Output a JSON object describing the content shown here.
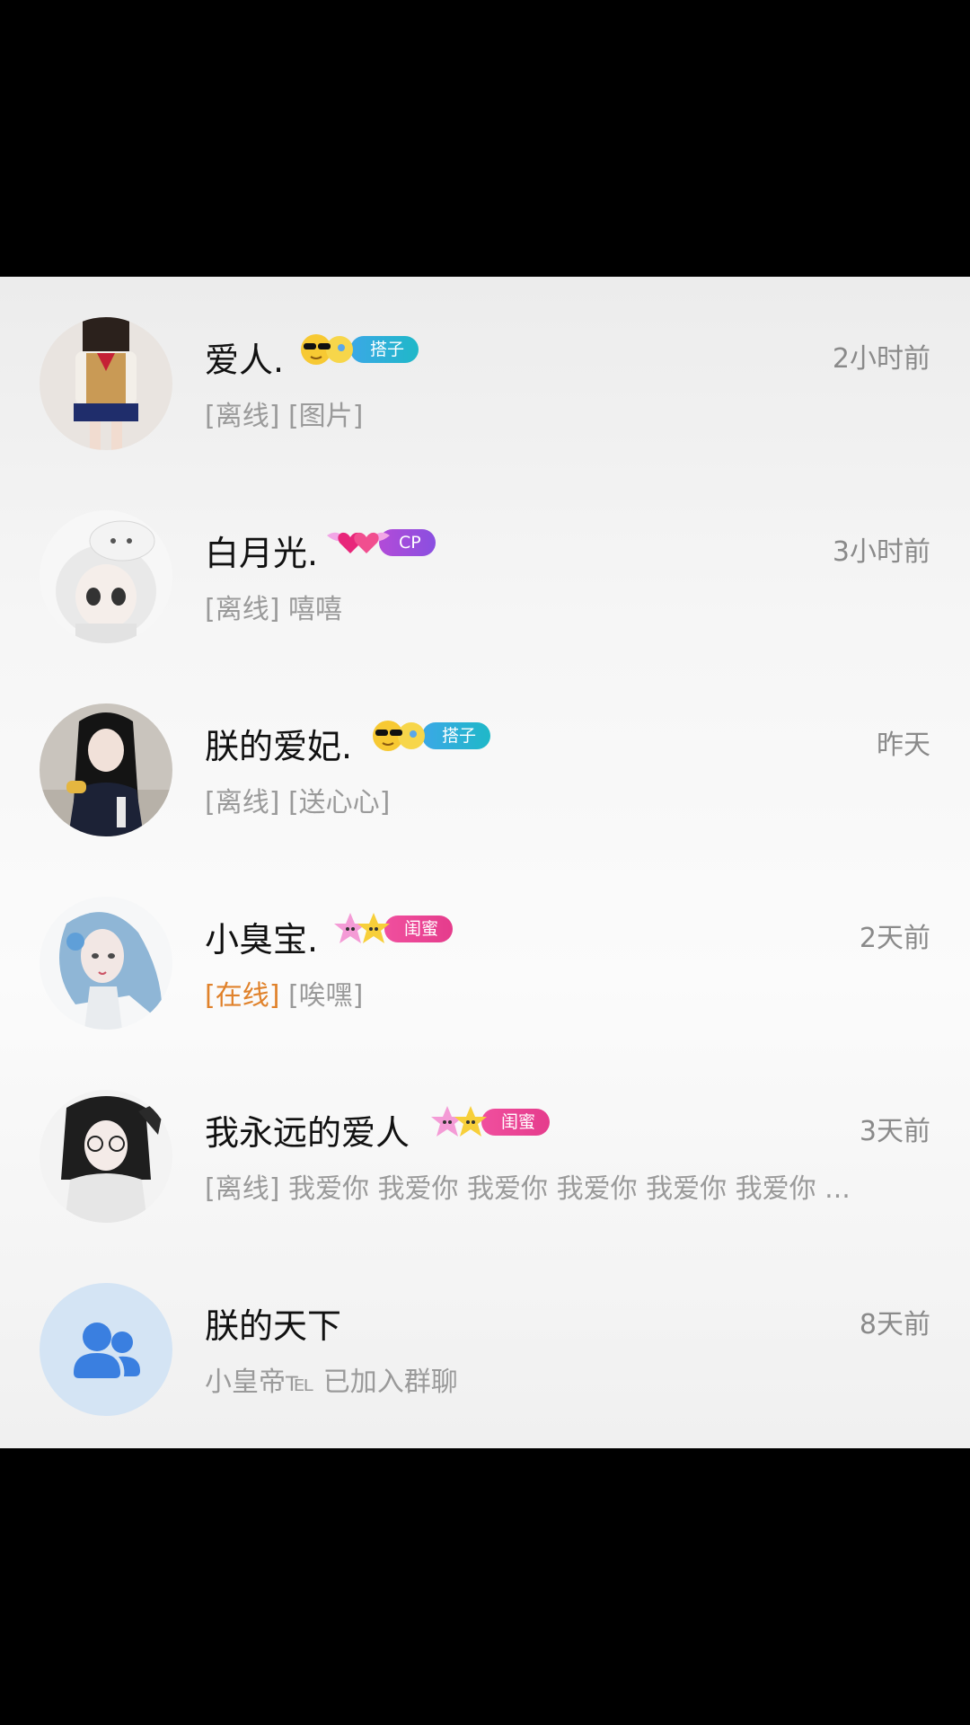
{
  "chats": [
    {
      "name": "爱人.",
      "badge": {
        "label": "搭子",
        "type": "dazi",
        "emoji": "sunglasses-sun-icon"
      },
      "time": "2小时前",
      "status": "[离线]",
      "online": false,
      "preview": " [图片]"
    },
    {
      "name": "白月光.",
      "badge": {
        "label": "CP",
        "type": "cp",
        "emoji": "winged-hearts-icon"
      },
      "time": "3小时前",
      "status": "[离线]",
      "online": false,
      "preview": " 嘻嘻"
    },
    {
      "name": "朕的爱妃.",
      "badge": {
        "label": "搭子",
        "type": "dazi",
        "emoji": "sunglasses-sun-icon"
      },
      "time": "昨天",
      "status": "[离线]",
      "online": false,
      "preview": " [送心心]"
    },
    {
      "name": "小臭宝.",
      "badge": {
        "label": "闺蜜",
        "type": "guimi",
        "emoji": "stars-icon"
      },
      "time": "2天前",
      "status": "[在线]",
      "online": true,
      "preview": " [唉嘿]"
    },
    {
      "name": "我永远的爱人",
      "badge": {
        "label": "闺蜜",
        "type": "guimi",
        "emoji": "stars-icon"
      },
      "time": "3天前",
      "status": "[离线]",
      "online": false,
      "preview": " 我爱你 我爱你 我爱你 我爱你 我爱你 我爱你 ..."
    },
    {
      "name": "朕的天下",
      "badge": null,
      "time": "8天前",
      "status": "",
      "online": false,
      "preview": "小皇帝℡ 已加入群聊"
    }
  ],
  "colors": {
    "online": "#e0822b",
    "muted": "#9a9a9a",
    "group_avatar_bg": "#d4e4f4",
    "group_icon": "#3a7fe0"
  }
}
